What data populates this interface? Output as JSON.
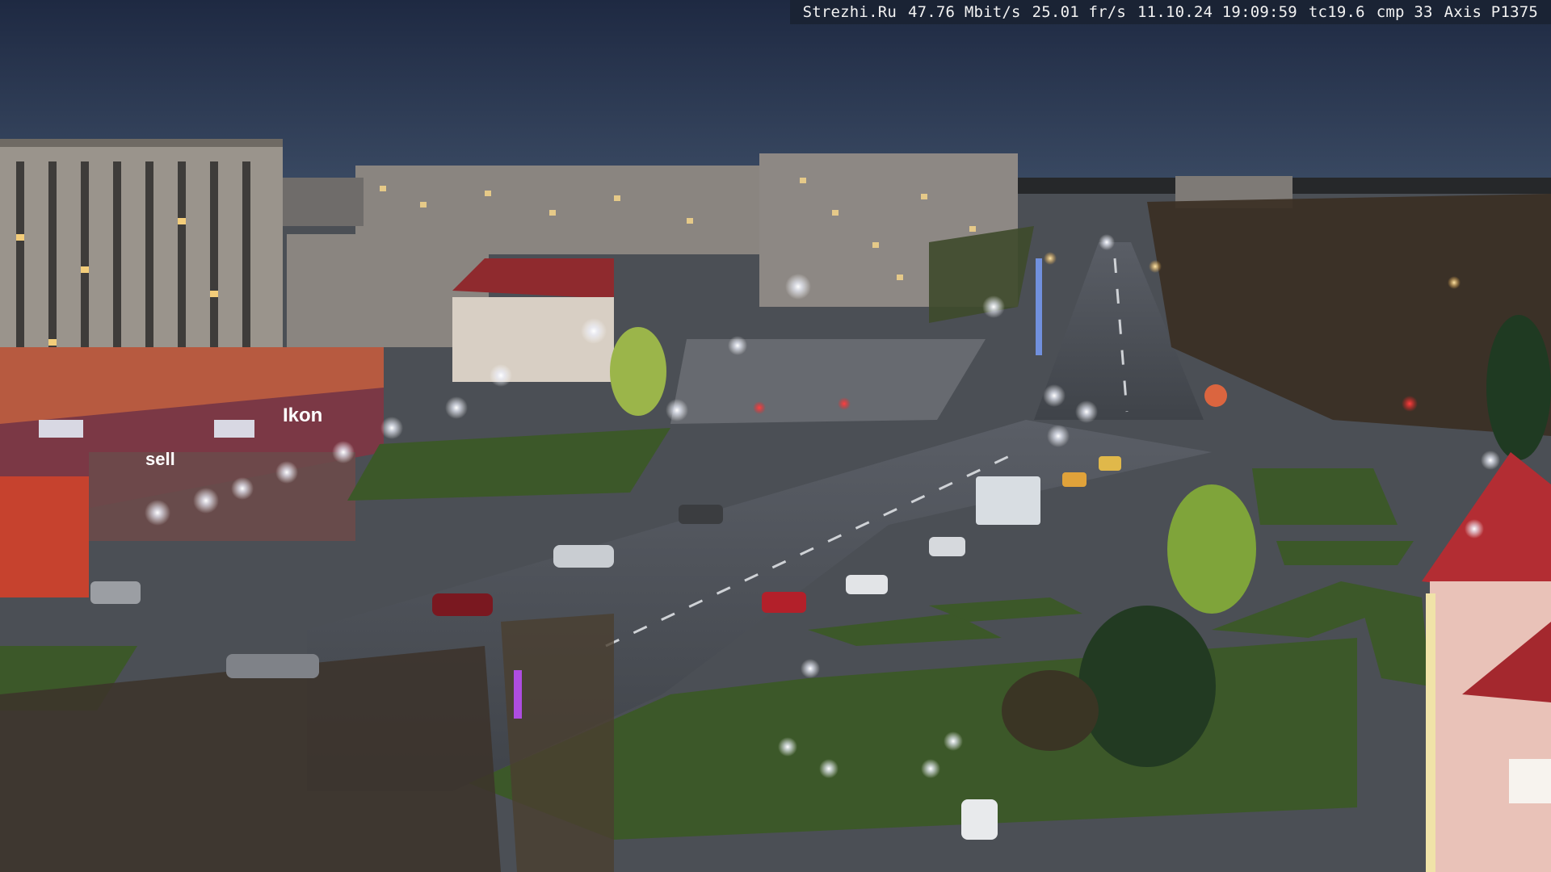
{
  "osd": {
    "site": "Strezhi.Ru",
    "bitrate": "47.76 Mbit/s",
    "framerate": "25.01 fr/s",
    "datetime": "11.10.24 19:09:59",
    "tc": "tc19.6",
    "cmp": "cmp 33",
    "camera": "Axis P1375"
  },
  "signs": {
    "store_main": "Ikon",
    "store_secondary": "sell"
  },
  "colors": {
    "sky_top": "#1e2942",
    "sky_horizon": "#3a4a63",
    "streetlight": "#f4f6ff",
    "grass": "#3d5a2a",
    "road": "#4a4e55",
    "red_building": "#b32d33"
  }
}
